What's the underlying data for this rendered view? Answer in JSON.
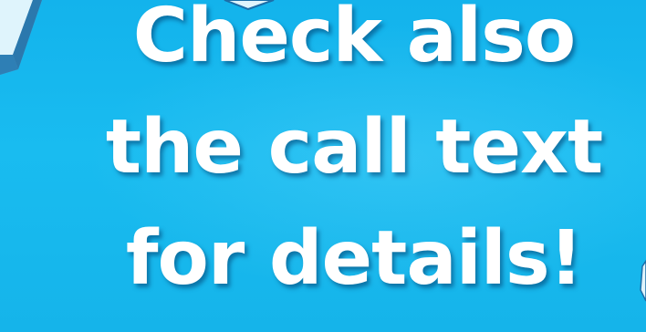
{
  "headline": {
    "lines": [
      "Check also",
      "the call text",
      "for details!"
    ]
  },
  "colors": {
    "background": "#17b9ee",
    "text": "#ffffff",
    "decor_fill": "#bfe9fb",
    "decor_stroke": "#1c6ea8"
  }
}
